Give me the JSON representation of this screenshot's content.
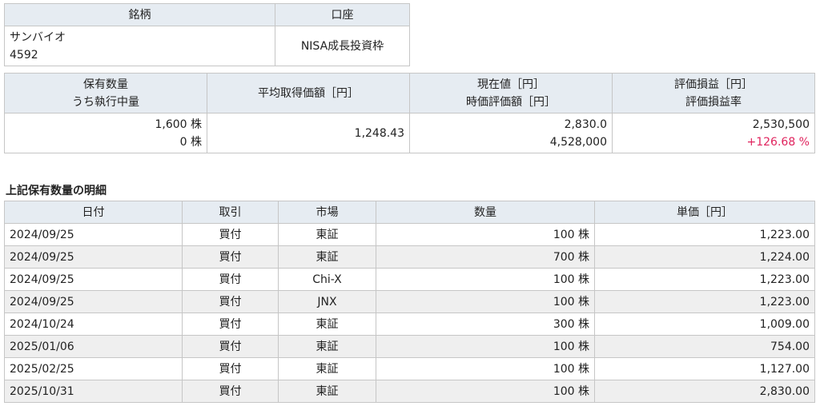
{
  "stock_table": {
    "headers": [
      "銘柄",
      "口座"
    ],
    "name": "サンバイオ",
    "code": "4592",
    "account": "NISA成長投資枠"
  },
  "summary_table": {
    "headers": [
      [
        "保有数量",
        "うち執行中量"
      ],
      [
        "平均取得価額［円］"
      ],
      [
        "現在値［円］",
        "時価評価額［円］"
      ],
      [
        "評価損益［円］",
        "評価損益率"
      ]
    ],
    "quantity": "1,600 株",
    "executing": "0 株",
    "avg_price": "1,248.43",
    "current_price": "2,830.0",
    "market_value": "4,528,000",
    "pnl": "2,530,500",
    "pnl_rate": "+126.68 %",
    "accent_color": "#e0245e"
  },
  "section_title": "上記保有数量の明細",
  "detail_table": {
    "headers": [
      "日付",
      "取引",
      "市場",
      "数量",
      "単価［円］"
    ],
    "rows": [
      [
        "2024/09/25",
        "買付",
        "東証",
        "100 株",
        "1,223.00"
      ],
      [
        "2024/09/25",
        "買付",
        "東証",
        "700 株",
        "1,224.00"
      ],
      [
        "2024/09/25",
        "買付",
        "Chi-X",
        "100 株",
        "1,223.00"
      ],
      [
        "2024/09/25",
        "買付",
        "JNX",
        "100 株",
        "1,223.00"
      ],
      [
        "2024/10/24",
        "買付",
        "東証",
        "300 株",
        "1,009.00"
      ],
      [
        "2025/01/06",
        "買付",
        "東証",
        "100 株",
        "754.00"
      ],
      [
        "2025/02/25",
        "買付",
        "東証",
        "100 株",
        "1,127.00"
      ],
      [
        "2025/10/31",
        "買付",
        "東証",
        "100 株",
        "2,830.00"
      ]
    ]
  }
}
